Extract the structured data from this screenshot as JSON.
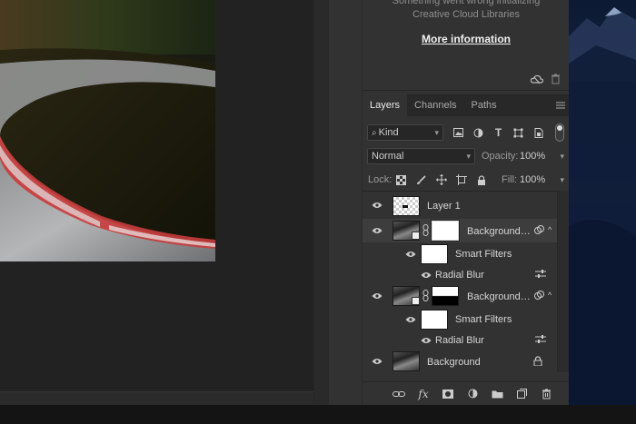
{
  "cc_panel": {
    "message_line1": "Something went wrong initializing",
    "message_line2": "Creative Cloud Libraries",
    "more_info_link": "More information"
  },
  "tabs": [
    {
      "label": "Layers",
      "active": true
    },
    {
      "label": "Channels",
      "active": false
    },
    {
      "label": "Paths",
      "active": false
    }
  ],
  "filter": {
    "kind_label": "Kind"
  },
  "blend": {
    "mode": "Normal",
    "opacity_label": "Opacity:",
    "opacity_value": "100%",
    "lock_label": "Lock:",
    "fill_label": "Fill:",
    "fill_value": "100%"
  },
  "layers": [
    {
      "name": "Layer 1"
    },
    {
      "name": "Background c..."
    },
    {
      "name": "Smart Filters"
    },
    {
      "name": "Radial Blur"
    },
    {
      "name": "Background c..."
    },
    {
      "name": "Smart Filters"
    },
    {
      "name": "Radial Blur"
    },
    {
      "name": "Background"
    }
  ],
  "icons": {
    "filter_icons": [
      "image-filter-icon",
      "adjustment-filter-icon",
      "type-filter-icon",
      "shape-filter-icon",
      "smart-object-filter-icon"
    ],
    "lock_icons": [
      "lock-transparent-icon",
      "lock-paint-icon",
      "lock-position-icon",
      "lock-artboard-icon",
      "lock-all-icon"
    ],
    "bottom_icons": [
      "link-layers-icon",
      "fx-icon",
      "add-mask-icon",
      "adjustment-layer-icon",
      "new-group-icon",
      "new-layer-icon",
      "delete-layer-icon"
    ]
  },
  "colors": {
    "panel_bg": "#323232",
    "tab_bar_bg": "#282828",
    "selected_row": "#3d3d3d",
    "text": "#d6d6d6"
  }
}
